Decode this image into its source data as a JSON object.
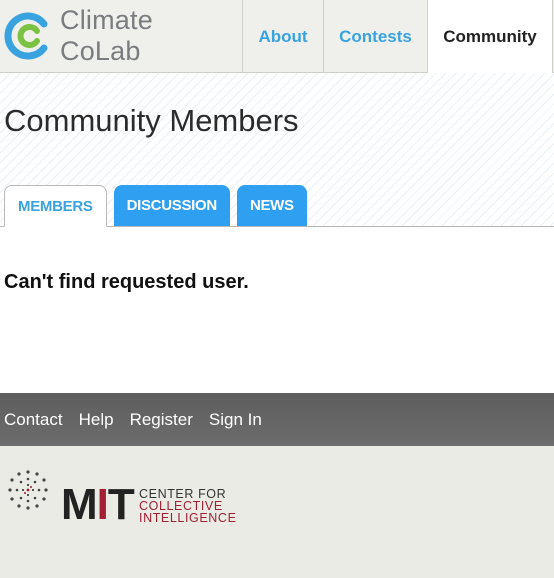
{
  "header": {
    "logo_text": "Climate CoLab",
    "nav": [
      {
        "label": "About"
      },
      {
        "label": "Contests"
      },
      {
        "label": "Community"
      }
    ]
  },
  "page": {
    "title": "Community Members",
    "tabs": [
      {
        "label": "MEMBERS"
      },
      {
        "label": "DISCUSSION"
      },
      {
        "label": "NEWS"
      }
    ],
    "message": "Can't find requested user."
  },
  "footer": {
    "links": [
      {
        "label": "Contact"
      },
      {
        "label": "Help"
      },
      {
        "label": "Register"
      },
      {
        "label": "Sign In"
      }
    ]
  },
  "sponsor": {
    "mit_letters": [
      "M",
      "I",
      "T"
    ],
    "center_lines": [
      "CENTER FOR",
      "COLLECTIVE",
      "INTELLIGENCE"
    ]
  },
  "colors": {
    "accent_blue": "#39a3e0",
    "tab_blue": "#2f9ff1",
    "mit_red": "#a31f34",
    "footer_gray": "#666666"
  }
}
